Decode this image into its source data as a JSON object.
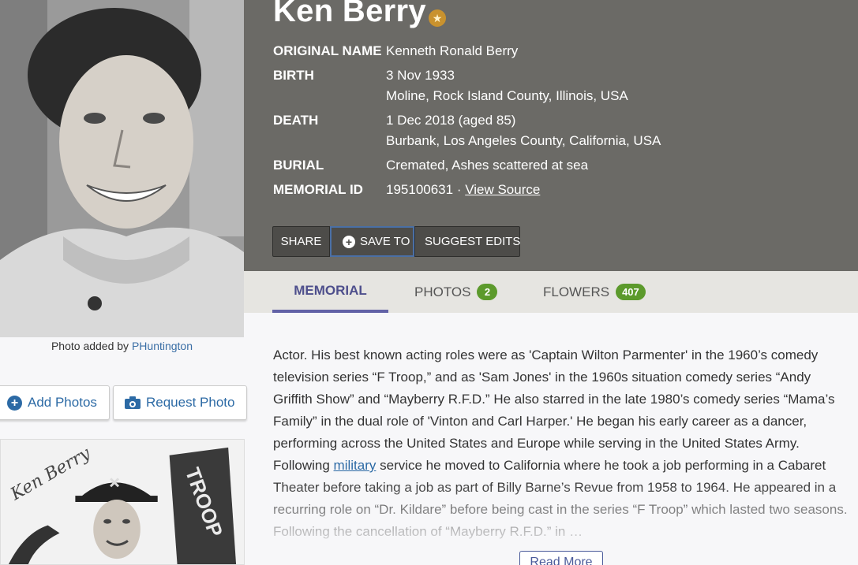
{
  "memorial": {
    "name": "Ken Berry",
    "badge_icon": "famous-star-icon",
    "facts": [
      {
        "label": "ORIGINAL NAME",
        "values": [
          "Kenneth Ronald Berry"
        ]
      },
      {
        "label": "BIRTH",
        "values": [
          "3 Nov 1933",
          "Moline, Rock Island County, Illinois, USA"
        ]
      },
      {
        "label": "DEATH",
        "values": [
          "1 Dec 2018 (aged 85)",
          "Burbank, Los Angeles County, California, USA"
        ]
      },
      {
        "label": "BURIAL",
        "values": [
          "Cremated, Ashes scattered at sea"
        ]
      },
      {
        "label": "MEMORIAL ID",
        "values": [
          "195100631 · "
        ],
        "link": "View Source"
      }
    ]
  },
  "actions": {
    "share": "SHARE",
    "save_to": "SAVE TO",
    "suggest_edits": "SUGGEST EDITS"
  },
  "tabs": {
    "memorial": "MEMORIAL",
    "photos": "PHOTOS",
    "photos_count": "2",
    "flowers": "FLOWERS",
    "flowers_count": "407"
  },
  "photo": {
    "caption_prefix": "Photo added by ",
    "added_by": "PHuntington",
    "add_photos": "Add Photos",
    "request_photo": "Request Photo",
    "signature": "Ken Berry",
    "flag_text": "TROOP"
  },
  "bio": {
    "part1": "Actor. His best known acting roles were as 'Captain Wilton Parmenter' in the 1960’s comedy television series “F Troop,” and as 'Sam Jones' in the 1960s situation comedy series “Andy Griffith Show” and “Mayberry R.F.D.” He also starred in the late 1980’s comedy series “Mama’s Family” in the dual role of 'Vinton and Carl Harper.' He began his early career as a dancer, performing across the United States and Europe while serving in the United States Army. Following ",
    "link": "military",
    "part2": " service he moved to California where he took a job performing in a Cabaret Theater before taking a job as part of Billy Barne’s Revue from 1958 to 1964. He appeared in a recurring role on “Dr. Kildare” before being cast in the series “F Troop” which lasted two seasons. Following the cancellation of “Mayberry R.F.D.” in …",
    "read_more": "Read More"
  },
  "colors": {
    "header_bg": "#6b6a66",
    "tab_active": "#4e4f8c",
    "badge_green": "#5c9a2c",
    "link_blue": "#2c6aa5"
  }
}
